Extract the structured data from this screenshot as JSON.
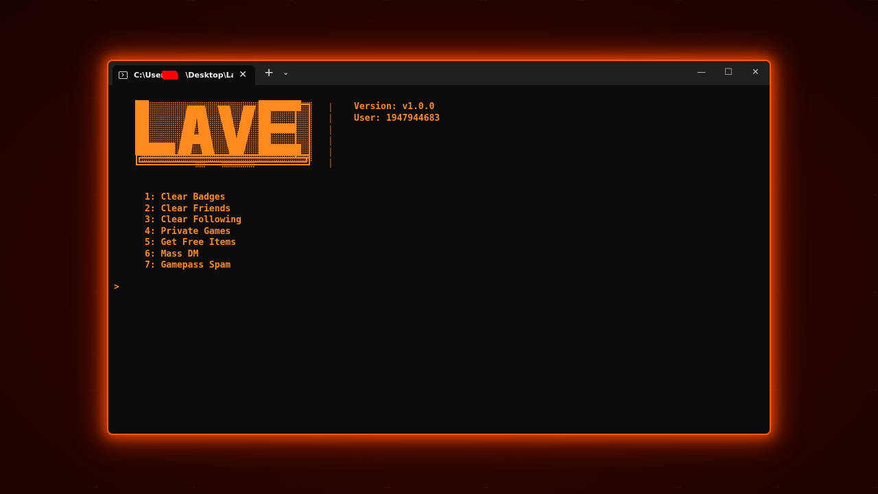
{
  "window": {
    "tab_title": "C:\\Users\\\\Desktop\\Lave\\l",
    "tab_title_left": "C:\\Users",
    "tab_title_right": "\\Desktop\\Lave\\l",
    "tab_close": "✕",
    "new_tab": "+",
    "dropdown": "⌄",
    "minimize": "—",
    "maximize": "☐",
    "close": "✕"
  },
  "terminal": {
    "logo_text": "LAVE",
    "info": {
      "version": "Version: v1.0.0",
      "user": "User: 1947944683"
    },
    "menu": [
      "1: Clear Badges",
      "2: Clear Friends",
      "3: Clear Following",
      "4: Private Games",
      "5: Get Free Items",
      "6: Mass DM",
      "7: Gamepass Spam"
    ],
    "prompt": ">"
  },
  "colors": {
    "accent": "#ff8a1e",
    "glow": "#ff5a00",
    "terminal_bg": "#0c0c0c",
    "titlebar_bg": "#202020",
    "background": "#2a0500",
    "redaction": "#ff0000"
  },
  "icons": {
    "tab": "terminal-icon"
  }
}
